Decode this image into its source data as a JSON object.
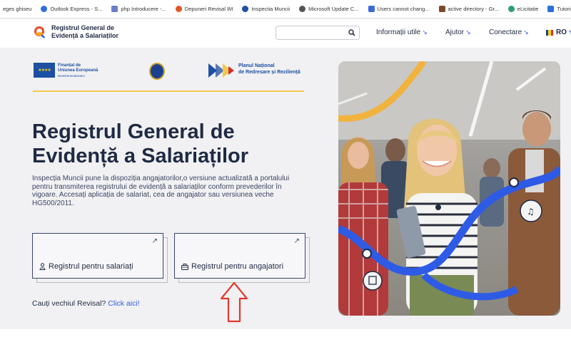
{
  "bookmarks": [
    {
      "label": "eges ghiseu",
      "color": "#ffffff"
    },
    {
      "label": "Outlook Express - S...",
      "color": "#2d6fd6"
    },
    {
      "label": "php Introducere -...",
      "color": "#6b7fc7"
    },
    {
      "label": "Depuneri Revisal IM",
      "color": "#e0582a"
    },
    {
      "label": "Inspectia Muncii",
      "color": "#1d4fa3"
    },
    {
      "label": "Microsoft Update C...",
      "color": "#555555"
    },
    {
      "label": "Users cannot chang...",
      "color": "#3c6ad8"
    },
    {
      "label": "active directory - Gr...",
      "color": "#7a4a2a"
    },
    {
      "label": "eLicitatie",
      "color": "#2f9e6f"
    },
    {
      "label": "Tutorial MySQL Co...",
      "color": "#2d6fd6"
    }
  ],
  "header": {
    "logo_line1": "Registrul General de",
    "logo_line2": "Evidență a Salariaților",
    "search_placeholder": "",
    "nav": [
      "Informații utile",
      "Ajutor",
      "Conectare"
    ],
    "nav_arrow": "↘",
    "language": "RO",
    "language_arrow": "↘"
  },
  "partners": {
    "eu_line1": "Finanțat de",
    "eu_line2": "Uniunea Europeană",
    "eu_line3": "NextGenerationEU",
    "pnrr_line1": "Planul Național",
    "pnrr_line2": "de Redresare și Reziliență"
  },
  "hero": {
    "title_line1": "Registrul General de",
    "title_line2": "Evidență a Salariaților",
    "description": "Inspecția Muncii pune la dispoziția angajatorilor,o versiune actualizată a portalului pentru transmiterea registrului de evidență a salariaților conform prevederilor în vigoare. Accesați aplicația de salariat, cea de angajator sau versiunea veche HG500/2011."
  },
  "cards": [
    {
      "label": "Registrul pentru salariați",
      "icon": "person-icon",
      "ext": "↗"
    },
    {
      "label": "Registrul pentru angajatori",
      "icon": "briefcase-icon",
      "ext": "↗"
    }
  ],
  "revisal": {
    "question": "Cauți vechiul Revisal?",
    "link": "Click aici!"
  },
  "colors": {
    "primary": "#1f2a44",
    "accent_blue": "#2e5be6",
    "accent_yellow": "#f2c94c",
    "annotation_red": "#e03a2f",
    "eu_blue": "#1d4fa3"
  }
}
